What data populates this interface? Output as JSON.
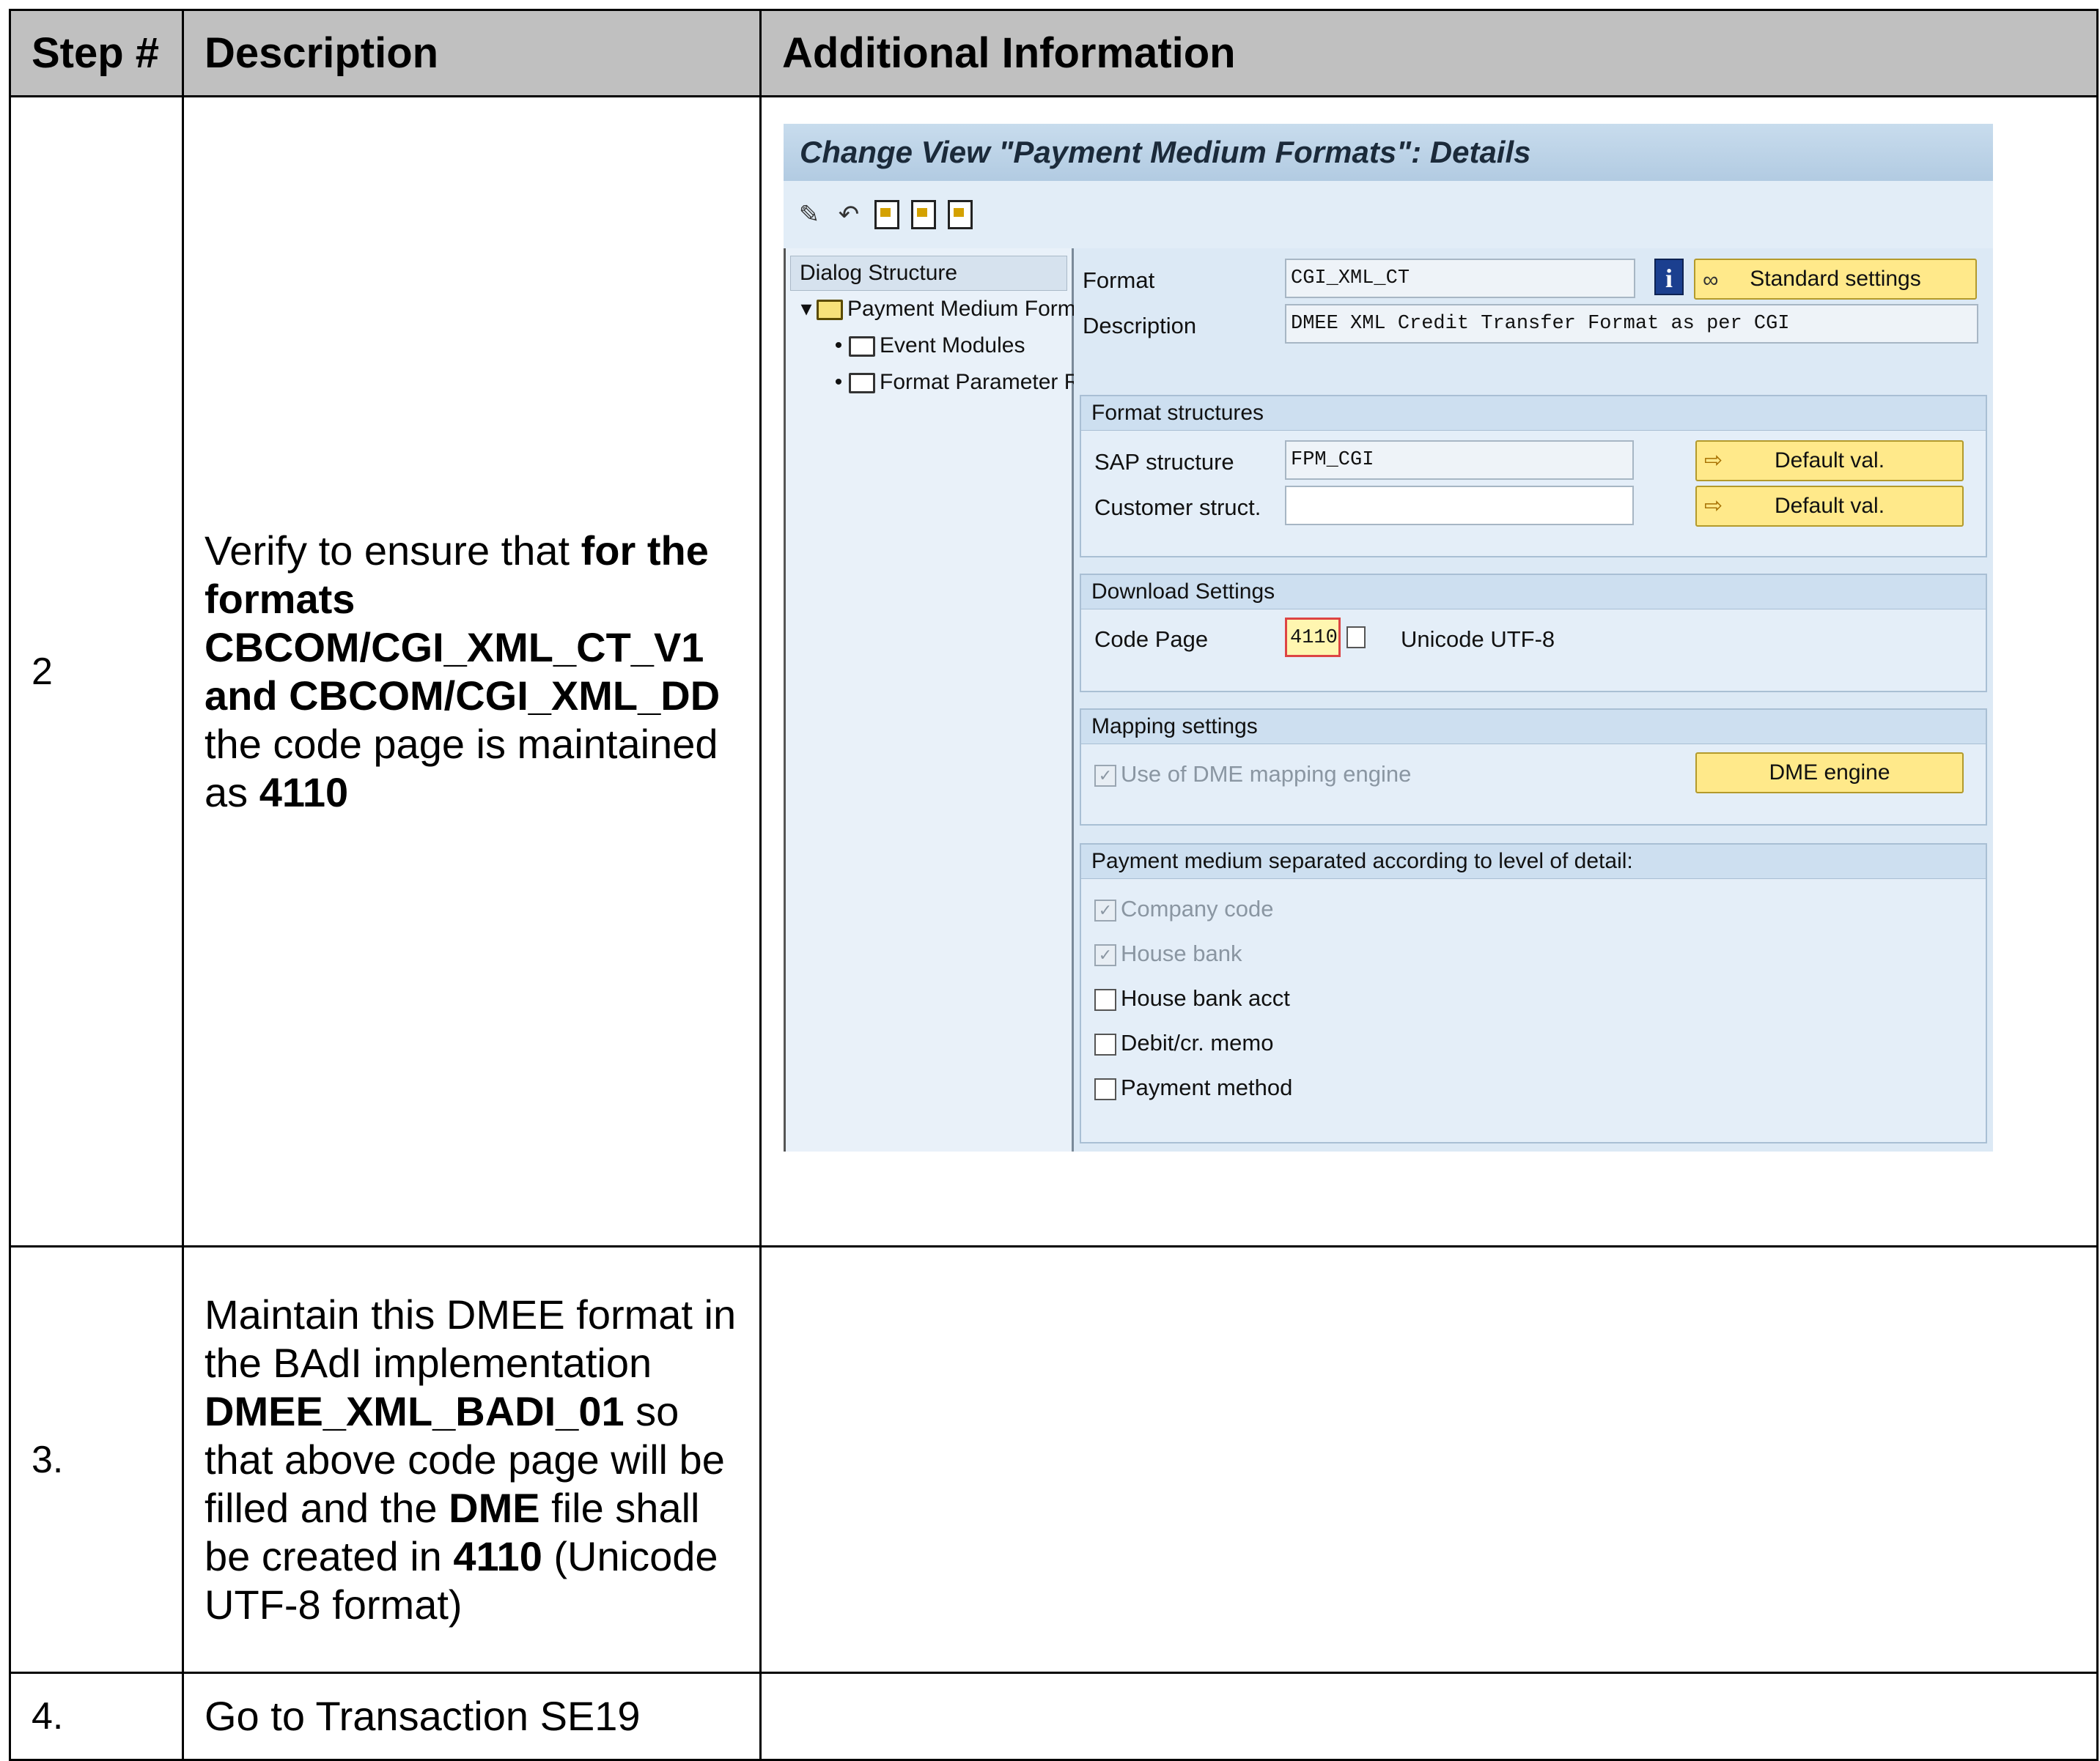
{
  "table": {
    "headers": {
      "step": "Step #",
      "description": "Description",
      "additional": "Additional Information"
    },
    "rows": [
      {
        "step": "2",
        "desc_parts": [
          "Verify to ensure that ",
          "for the formats CBCOM/CGI_XML_CT_V1 and CBCOM/CGI_XML_DD",
          " the code page is maintained as ",
          "4110"
        ]
      },
      {
        "step": "3.",
        "desc_parts": [
          "Maintain this DMEE format in the BAdI implementation ",
          "DMEE_XML_BADI_01",
          " so that above code page will be filled and the ",
          "DME",
          " file shall be created in ",
          "4110",
          " (Unicode UTF-8 format)"
        ]
      },
      {
        "step": "4.",
        "desc_parts": [
          "Go to Transaction SE19"
        ]
      }
    ]
  },
  "sap": {
    "title": "Change View \"Payment Medium Formats\": Details",
    "toolbar_icons": [
      "pencil-icon",
      "undo-icon",
      "doc-icon",
      "doc-next-icon",
      "doc-list-icon"
    ],
    "tree": {
      "header": "Dialog Structure",
      "items": [
        "Payment Medium Form",
        "Event Modules",
        "Format Parameter R"
      ]
    },
    "format_label": "Format",
    "format_value": "CGI_XML_CT",
    "description_label": "Description",
    "description_value": "DMEE XML Credit Transfer Format as per CGI",
    "info_icon": "i",
    "standard_settings": "Standard settings",
    "format_structures": {
      "header": "Format structures",
      "sap_structure_label": "SAP structure",
      "sap_structure_value": "FPM_CGI",
      "customer_struct_label": "Customer struct.",
      "customer_struct_value": "",
      "default_val_1": "Default val.",
      "default_val_2": "Default val."
    },
    "download_settings": {
      "header": "Download Settings",
      "code_page_label": "Code Page",
      "code_page_value": "4110",
      "code_page_text": "Unicode UTF-8"
    },
    "mapping_settings": {
      "header": "Mapping settings",
      "checkbox_label": "Use of DME mapping engine",
      "checked": true,
      "button": "DME engine"
    },
    "payment_medium": {
      "header": "Payment medium separated according to level of detail:",
      "options": [
        {
          "label": "Company code",
          "checked": true,
          "disabled": true
        },
        {
          "label": "House bank",
          "checked": true,
          "disabled": true
        },
        {
          "label": "House bank acct",
          "checked": false,
          "disabled": false
        },
        {
          "label": "Debit/cr. memo",
          "checked": false,
          "disabled": false
        },
        {
          "label": "Payment method",
          "checked": false,
          "disabled": false
        }
      ]
    }
  }
}
